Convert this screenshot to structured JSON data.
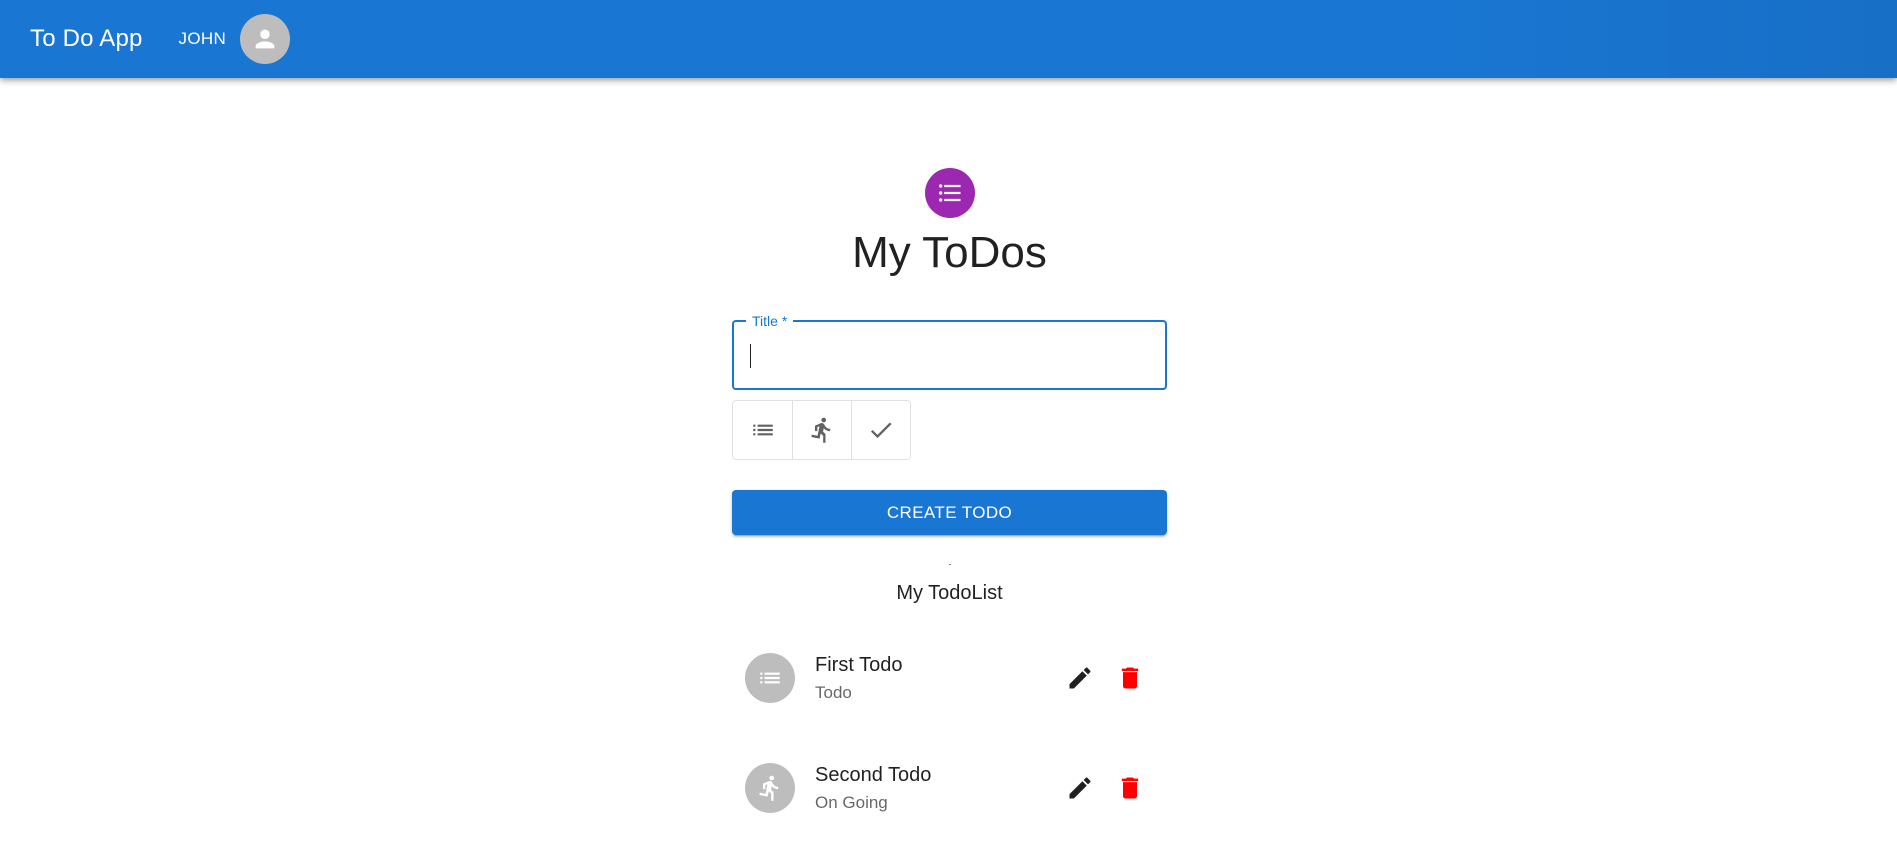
{
  "appbar": {
    "title": "To Do App",
    "user_name": "John",
    "avatar_icon": "person-icon",
    "color": "#1976d2"
  },
  "main": {
    "header_icon": "list-icon",
    "header_icon_color": "#9c27b0",
    "title": "My ToDos",
    "title_field": {
      "label": "Title *",
      "value": "",
      "placeholder": ""
    },
    "status_toggles": [
      {
        "icon": "list-icon",
        "status": "Todo"
      },
      {
        "icon": "running-icon",
        "status": "On Going"
      },
      {
        "icon": "check-icon",
        "status": "Done"
      }
    ],
    "create_button": "Create Todo",
    "list_title": "My TodoList"
  },
  "todos": [
    {
      "title": "First Todo",
      "status": "Todo",
      "icon": "list-icon"
    },
    {
      "title": "Second Todo",
      "status": "On Going",
      "icon": "running-icon"
    }
  ],
  "colors": {
    "edit": "#212121",
    "delete": "#ff0000",
    "avatar_gray": "#bdbdbd"
  }
}
